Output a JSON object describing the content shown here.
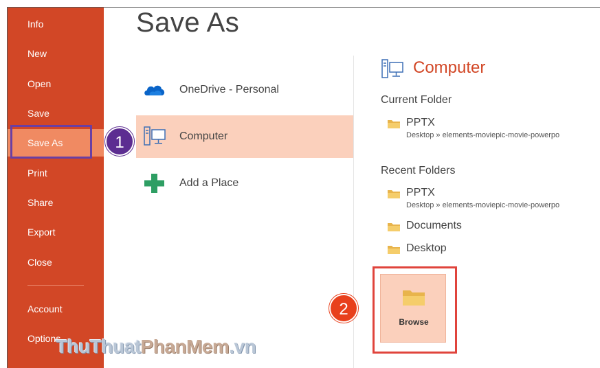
{
  "title": "Save As",
  "sidebar": {
    "items": [
      {
        "label": "Info"
      },
      {
        "label": "New"
      },
      {
        "label": "Open"
      },
      {
        "label": "Save"
      },
      {
        "label": "Save As",
        "active": true
      },
      {
        "label": "Print"
      },
      {
        "label": "Share"
      },
      {
        "label": "Export"
      },
      {
        "label": "Close"
      },
      {
        "label": "Account"
      },
      {
        "label": "Options"
      }
    ]
  },
  "locations": [
    {
      "label": "OneDrive - Personal",
      "icon": "cloud-icon"
    },
    {
      "label": "Computer",
      "icon": "computer-icon",
      "selected": true
    },
    {
      "label": "Add a Place",
      "icon": "plus-icon"
    }
  ],
  "steps": {
    "one": "1",
    "two": "2"
  },
  "right_panel": {
    "heading": "Computer",
    "current_folder_label": "Current Folder",
    "current_folder": {
      "name": "PPTX",
      "path": "Desktop » elements-moviepic-movie-powerpo"
    },
    "recent_folders_label": "Recent Folders",
    "recent_folders": [
      {
        "name": "PPTX",
        "path": "Desktop » elements-moviepic-movie-powerpo"
      },
      {
        "name": "Documents"
      },
      {
        "name": "Desktop"
      }
    ],
    "browse_label": "Browse"
  },
  "watermark": {
    "part1": "ThuThuat",
    "part2": "PhanMem",
    "part3": ".vn"
  },
  "colors": {
    "sidebar": "#d24726",
    "sidebar_active": "#f08a62",
    "selected": "#fbd0bc",
    "accent": "#d24726",
    "step1": "#5c2d91",
    "step2": "#e8401c",
    "highlight_red": "#e0443c"
  }
}
